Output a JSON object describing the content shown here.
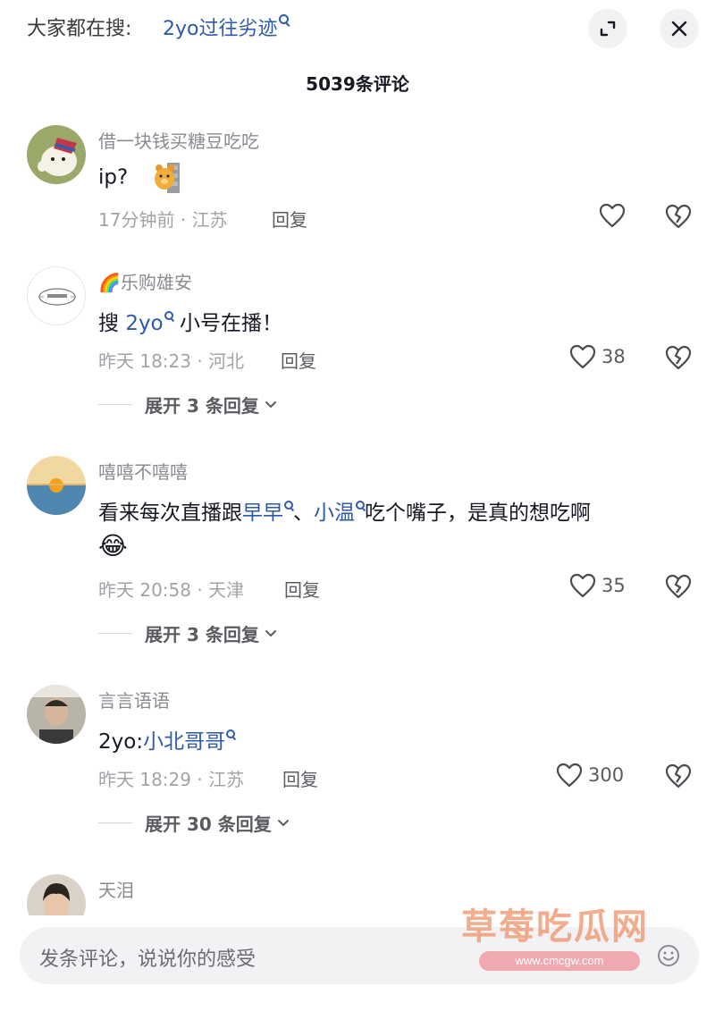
{
  "header": {
    "search_prefix": "大家都在搜:",
    "search_keyword": "2yo过往劣迹",
    "comment_count": "5039条评论"
  },
  "comments": [
    {
      "username": "借一块钱买糖豆吃吃",
      "text": "ip?",
      "sticker": "bear-sticker",
      "time_location": "17分钟前 · 江苏",
      "reply_label": "回复",
      "likes": ""
    },
    {
      "username_emoji": "🌈",
      "username": "乐购雄安",
      "text_prefix": "搜 ",
      "keyword": "2yo",
      "text_suffix": " 小号在播！",
      "time_location": "昨天 18:23 · 河北",
      "reply_label": "回复",
      "likes": "38",
      "expand_label": "展开 3 条回复"
    },
    {
      "username": "嘻嘻不嘻嘻",
      "text_prefix": "看来每次直播跟",
      "keyword1": "早早",
      "separator": "、",
      "keyword2": "小温",
      "text_suffix": "吃个嘴子，是真的想吃啊",
      "emoji": "😂",
      "time_location": "昨天 20:58 · 天津",
      "reply_label": "回复",
      "likes": "35",
      "expand_label": "展开 3 条回复"
    },
    {
      "username": "言言语语",
      "text_prefix": "2yo:",
      "keyword": "小北哥哥",
      "time_location": "昨天 18:29 · 江苏",
      "reply_label": "回复",
      "likes": "300",
      "expand_label": "展开 30 条回复"
    },
    {
      "username": "天泪"
    }
  ],
  "input": {
    "placeholder": "发条评论，说说你的感受"
  },
  "watermark": {
    "title": "草莓吃瓜网",
    "url": "www.cmcgw.com"
  },
  "colors": {
    "keyword_blue": "#2f5aa8",
    "text_dark": "#161823",
    "text_gray": "#a2a3a7"
  }
}
